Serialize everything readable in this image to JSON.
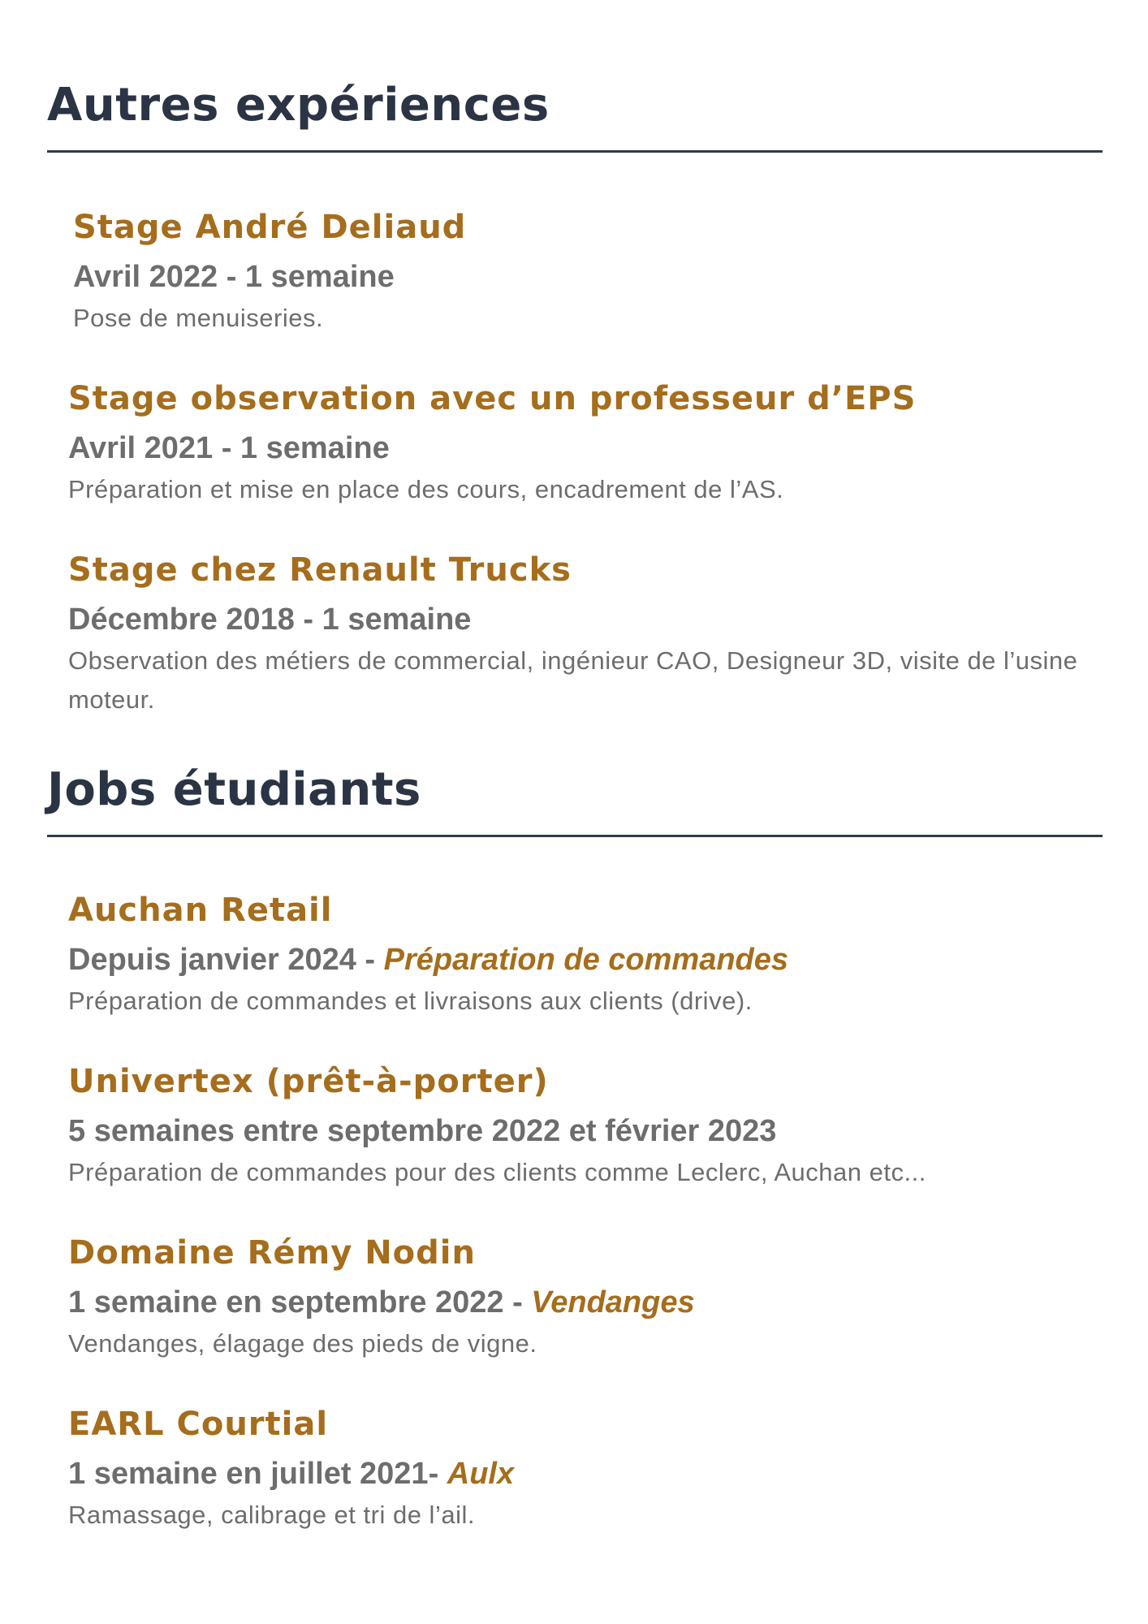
{
  "sections": [
    {
      "title": "Autres expériences",
      "entries": [
        {
          "title": "Stage André Deliaud",
          "meta": "Avril 2022 - 1 semaine",
          "desc": "Pose de menuiseries."
        },
        {
          "title": "Stage observation avec un professeur d’EPS",
          "meta": "Avril 2021 - 1 semaine",
          "desc": "Préparation et mise en place des cours, encadrement de l’AS."
        },
        {
          "title": "Stage chez Renault Trucks",
          "meta": "Décembre 2018 - 1 semaine",
          "desc": "Observation des métiers de commercial, ingénieur CAO, Designeur 3D, visite de l’usine moteur."
        }
      ]
    },
    {
      "title": "Jobs étudiants",
      "entries": [
        {
          "title": "Auchan Retail",
          "meta": "Depuis janvier 2024 - ",
          "role": "Préparation de commandes",
          "desc": "Préparation de commandes et livraisons aux clients (drive)."
        },
        {
          "title": "Univertex (prêt-à-porter)",
          "meta": "5 semaines entre septembre 2022 et février 2023",
          "desc": "Préparation de commandes pour des clients comme Leclerc, Auchan etc..."
        },
        {
          "title": "Domaine Rémy Nodin",
          "meta": "1 semaine en septembre 2022 - ",
          "role": "Vendanges",
          "desc": "Vendanges, élagage des pieds de vigne."
        },
        {
          "title": "EARL Courtial",
          "meta": "1 semaine en juillet 2021- ",
          "role": "Aulx",
          "desc": "Ramassage, calibrage et tri de l’ail."
        }
      ]
    }
  ]
}
